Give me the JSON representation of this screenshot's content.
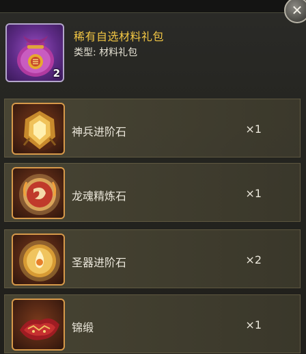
{
  "package": {
    "name": "稀有自选材料礼包",
    "type_label": "类型: 材料礼包",
    "count": "2",
    "icon": "purple-pouch-icon"
  },
  "close": {
    "glyph": "✕",
    "icon": "close-icon"
  },
  "items": [
    {
      "name": "神兵进阶石",
      "qty": "×1",
      "icon": "golden-gem-stone-icon"
    },
    {
      "name": "龙魂精炼石",
      "qty": "×1",
      "icon": "red-dragon-orb-icon"
    },
    {
      "name": "圣器进阶石",
      "qty": "×2",
      "icon": "golden-flame-orb-icon"
    },
    {
      "name": "锦缎",
      "qty": "×1",
      "icon": "red-brocade-cloth-icon"
    }
  ],
  "colors": {
    "title": "#f3c744",
    "icon_border_gold": "#d89a4a",
    "icon_border_purple": "#b4a7cc"
  }
}
